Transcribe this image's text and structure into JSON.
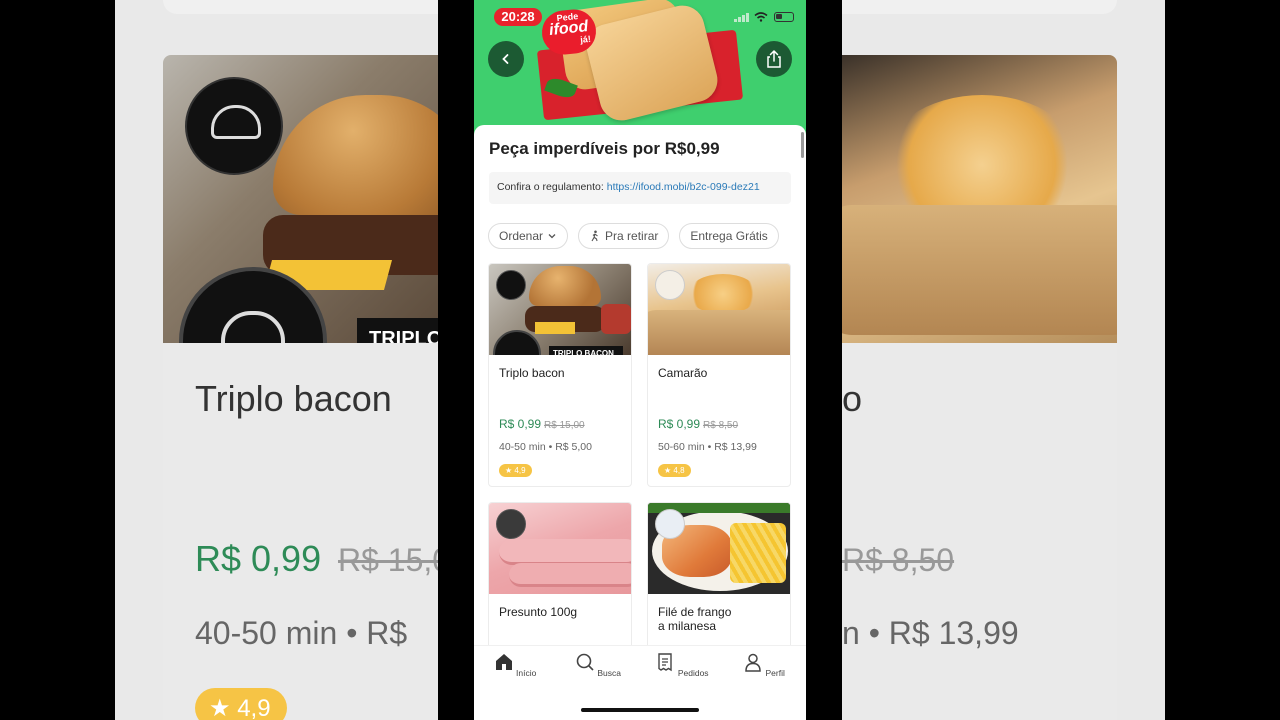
{
  "status": {
    "time": "20:28"
  },
  "brand": {
    "line1": "Pede",
    "line2": "ifood",
    "line3": "já!"
  },
  "page": {
    "title": "Peça imperdíveis por R$0,99",
    "rules_prefix": "Confira o regulamento:",
    "rules_link": "https://ifood.mobi/b2c-099-dez21"
  },
  "filters": [
    {
      "label": "Ordenar"
    },
    {
      "label": "Pra retirar"
    },
    {
      "label": "Entrega Grátis"
    }
  ],
  "products": [
    {
      "name": "Triplo bacon",
      "price": "R$ 0,99",
      "old_price": "R$ 15,00",
      "meta": "40-50 min • R$ 5,00",
      "rating": "4,9",
      "image_tag": "TRIPLO BACON"
    },
    {
      "name": "Camarão",
      "price": "R$ 0,99",
      "old_price": "R$ 8,50",
      "meta": "50-60 min • R$ 13,99",
      "rating": "4,8"
    },
    {
      "name": "Presunto 100g"
    },
    {
      "name": "Filé de frango\na milanesa"
    }
  ],
  "tabs": [
    {
      "label": "Início",
      "icon": "home-icon"
    },
    {
      "label": "Busca",
      "icon": "search-icon"
    },
    {
      "label": "Pedidos",
      "icon": "receipt-icon"
    },
    {
      "label": "Perfil",
      "icon": "profile-icon"
    }
  ],
  "background": {
    "left_title": "Triplo bacon",
    "left_price": "R$ 0,99",
    "left_old": "R$ 15,0",
    "left_meta": "40-50 min • R$",
    "left_rating": "4,9",
    "left_tag": "TRIPLO",
    "right_title": "o",
    "right_old": "R$ 8,50",
    "right_meta": "n • R$ 13,99"
  },
  "colors": {
    "brand_red": "#ea1d2c",
    "hero_green": "#3fcf6e",
    "price_green": "#2e8b57",
    "rating_yellow": "#f6c445"
  }
}
